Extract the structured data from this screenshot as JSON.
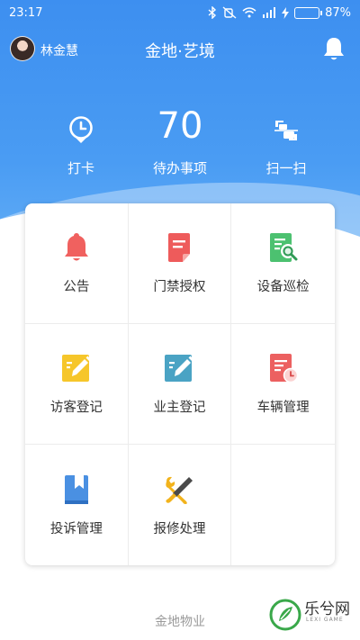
{
  "status_bar": {
    "time": "23:17",
    "battery_percent_label": "87%",
    "battery_level": 0.87,
    "icons": [
      "bluetooth-icon",
      "mute-icon",
      "wifi-icon",
      "signal-icon",
      "charging-icon"
    ]
  },
  "header": {
    "user_name": "林金慧",
    "title": "金地·艺境",
    "bell_icon": "bell-icon"
  },
  "quick_actions": {
    "clock_in": {
      "label": "打卡",
      "icon": "clock-icon"
    },
    "pending": {
      "count": "70",
      "label": "待办事项"
    },
    "scan": {
      "label": "扫一扫",
      "icon": "scan-icon"
    }
  },
  "grid_items": [
    {
      "label": "公告",
      "icon": "bell-icon",
      "color": "#f0615f"
    },
    {
      "label": "门禁授权",
      "icon": "document-icon",
      "color": "#ee5b5b"
    },
    {
      "label": "设备巡检",
      "icon": "inspection-icon",
      "color": "#4cc170"
    },
    {
      "label": "访客登记",
      "icon": "edit-icon",
      "color": "#f6c62a"
    },
    {
      "label": "业主登记",
      "icon": "edit-icon",
      "color": "#4aa3c4"
    },
    {
      "label": "车辆管理",
      "icon": "document-clock-icon",
      "color": "#ec6060"
    },
    {
      "label": "投诉管理",
      "icon": "bookmark-icon",
      "color": "#4a90e2"
    },
    {
      "label": "报修处理",
      "icon": "tools-icon",
      "color": "#f2b31c"
    }
  ],
  "footer": {
    "text": "金地物业"
  },
  "watermark": {
    "brand": "乐兮网",
    "sub": "LEXI GAME"
  },
  "colors": {
    "primary": "#3d8ff0",
    "card_border": "#ececec"
  }
}
